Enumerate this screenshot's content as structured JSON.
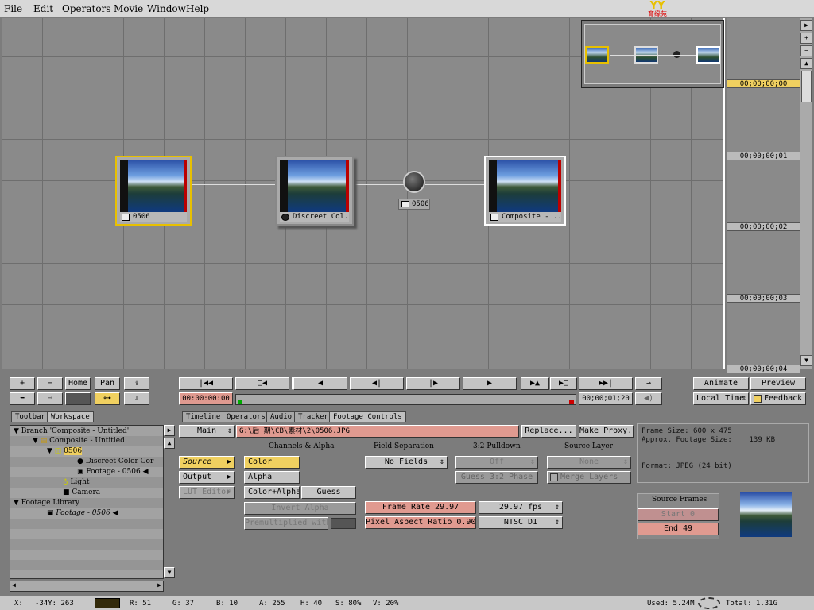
{
  "menu": [
    "File",
    "Edit",
    "Operators",
    "Movie",
    "Window",
    "Help"
  ],
  "logo": {
    "mark": "YY",
    "text": "育缘苑"
  },
  "nodes": [
    {
      "label": "0506",
      "icon": "footage-icon"
    },
    {
      "label": "Discreet Col...",
      "icon": "sphere-icon"
    },
    {
      "label": "0506",
      "icon": "layer-icon"
    },
    {
      "label": "Composite - ...",
      "icon": "composite-icon"
    }
  ],
  "timeline": {
    "marks": [
      "00;00;00;00",
      "00;00;00;01",
      "00;00;00;02",
      "00;00;00;03",
      "00;00;00;04"
    ]
  },
  "toolbar": {
    "home": "Home",
    "pan": "Pan",
    "animate": "Animate",
    "preview": "Preview",
    "local_time": "Local Time",
    "feedback": "Feedback"
  },
  "transport": {
    "timecode_start": "00:00:00:00",
    "timecode_end": "00;00;01;20"
  },
  "tabs_left": [
    "Toolbar",
    "Workspace"
  ],
  "tabs_main": [
    "Timeline",
    "Operators",
    "Audio",
    "Tracker",
    "Footage Controls"
  ],
  "tree": [
    "Branch 'Composite - Untitled'",
    "Composite - Untitled",
    "0506",
    "Discreet Color Cor",
    "Footage - 0506",
    "Light",
    "Camera",
    "Footage Library",
    "Footage - 0506"
  ],
  "footage": {
    "main_select": "Main",
    "path": "G:\\后 期\\CB\\素材\\2\\0506.JPG",
    "replace": "Replace...",
    "make_proxy": "Make Proxy...",
    "left_buttons": [
      "Source",
      "Output",
      "LUT Editor"
    ],
    "channels_header": "Channels & Alpha",
    "channels": [
      "Color",
      "Alpha",
      "Color+Alpha"
    ],
    "guess": "Guess",
    "invert_alpha": "Invert Alpha",
    "premultiplied": "Premultiplied with",
    "field_sep_header": "Field Separation",
    "no_fields": "No Fields",
    "pulldown_header": "3:2 Pulldown",
    "pulldown_value": "Off",
    "guess_phase": "Guess 3:2 Phase",
    "source_layer_header": "Source Layer",
    "source_layer_value": "None",
    "merge_layers": "Merge Layers",
    "frame_rate": "Frame Rate 29.97",
    "fps_value": "29.97 fps",
    "pixel_aspect": "Pixel Aspect Ratio 0.90",
    "ntsc": "NTSC D1",
    "source_frames": "Source Frames",
    "start": "Start 0",
    "end": "End 49"
  },
  "info": {
    "frame_size": "Frame Size: 600 x 475",
    "approx": "Approx. Footage Size:",
    "approx_val": "139 KB",
    "format": "Format: JPEG (24 bit)"
  },
  "status": {
    "x": "X:",
    "coords": "-34Y:  263",
    "r": "R: 51",
    "g": "G: 37",
    "b": "B: 10",
    "a": "A: 255",
    "h": "H: 40",
    "s": "S: 80%",
    "v": "V: 20%",
    "used": "Used: 5.24M",
    "total": "Total: 1.31G"
  }
}
